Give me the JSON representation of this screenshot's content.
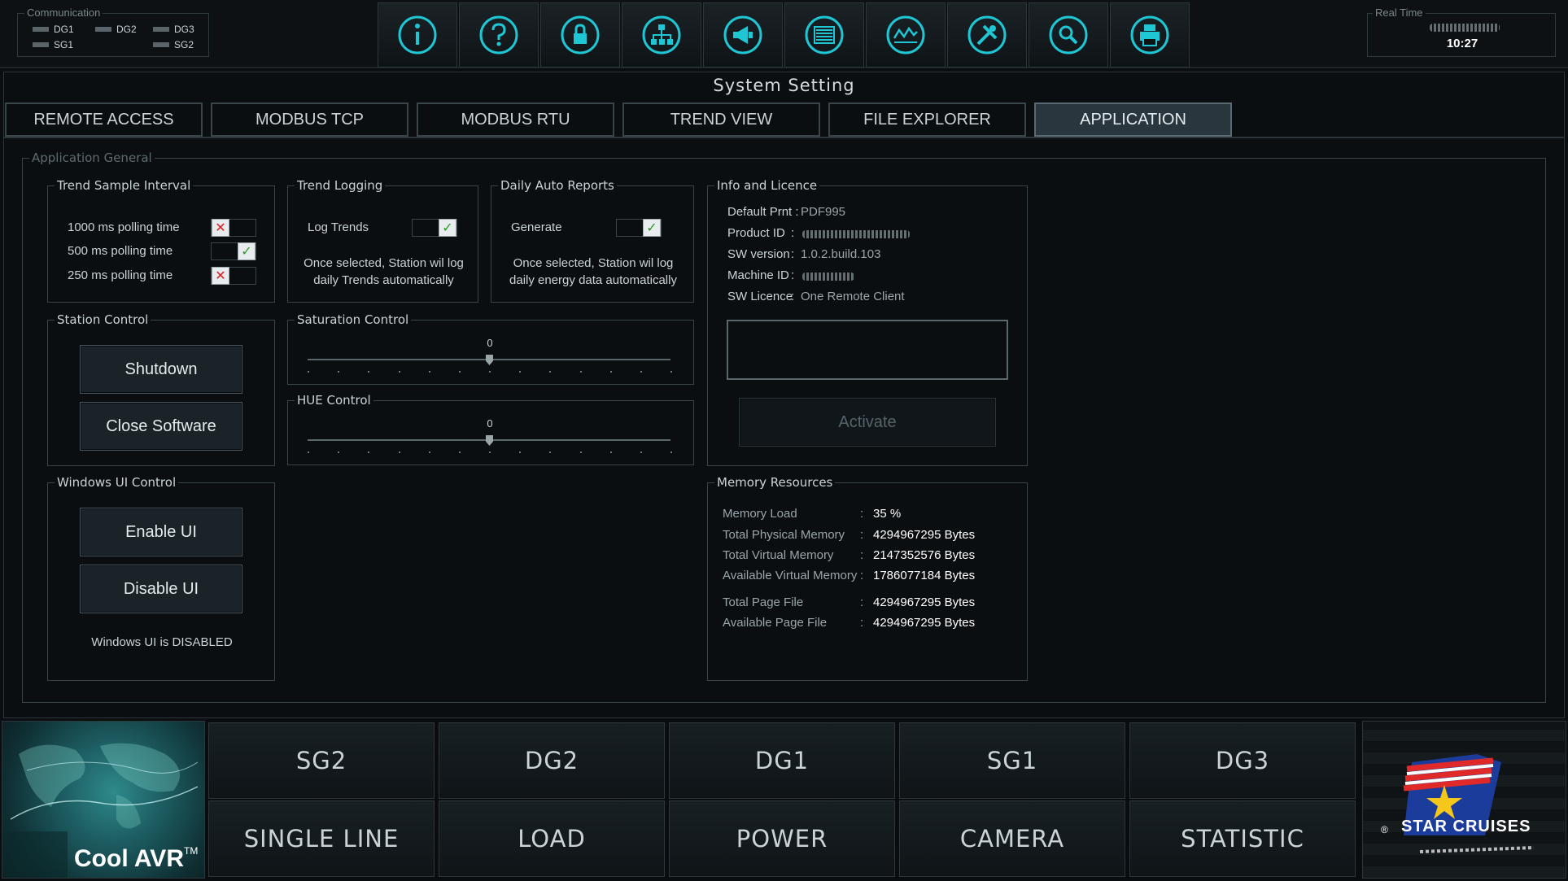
{
  "header": {
    "communication": {
      "title": "Communication",
      "items": [
        "DG1",
        "DG2",
        "DG3",
        "SG1",
        "SG2"
      ]
    },
    "toolbar": [
      {
        "icon": "info-icon"
      },
      {
        "icon": "help-icon"
      },
      {
        "icon": "lock-icon"
      },
      {
        "icon": "network-icon"
      },
      {
        "icon": "alarm-horn-icon"
      },
      {
        "icon": "list-icon"
      },
      {
        "icon": "trend-icon"
      },
      {
        "icon": "tools-icon"
      },
      {
        "icon": "search-icon"
      },
      {
        "icon": "printer-icon"
      }
    ],
    "real_time": {
      "title": "Real Time",
      "time": "10:27"
    }
  },
  "page_title": "System Setting",
  "tabs": [
    {
      "label": "REMOTE ACCESS",
      "active": false
    },
    {
      "label": "MODBUS TCP",
      "active": false
    },
    {
      "label": "MODBUS RTU",
      "active": false
    },
    {
      "label": "TREND VIEW",
      "active": false
    },
    {
      "label": "FILE EXPLORER",
      "active": false
    },
    {
      "label": "APPLICATION",
      "active": true
    }
  ],
  "application_general": {
    "title": "Application General",
    "trend_sample_interval": {
      "title": "Trend Sample Interval",
      "options": [
        {
          "label": "1000 ms polling time",
          "checked": false
        },
        {
          "label": "500 ms polling time",
          "checked": true
        },
        {
          "label": "250 ms polling time",
          "checked": false
        }
      ]
    },
    "trend_logging": {
      "title": "Trend Logging",
      "option_label": "Log Trends",
      "checked": true,
      "note_line1": "Once selected, Station wil log",
      "note_line2": "daily Trends automatically"
    },
    "daily_auto_reports": {
      "title": "Daily Auto Reports",
      "option_label": "Generate",
      "checked": true,
      "note_line1": "Once selected, Station wil log",
      "note_line2": "daily energy data automatically"
    },
    "station_control": {
      "title": "Station Control",
      "shutdown_label": "Shutdown",
      "close_label": "Close Software"
    },
    "saturation_control": {
      "title": "Saturation Control",
      "value": "0"
    },
    "hue_control": {
      "title": "HUE Control",
      "value": "0"
    },
    "windows_ui_control": {
      "title": "Windows UI Control",
      "enable_label": "Enable UI",
      "disable_label": "Disable UI",
      "status": "Windows UI is DISABLED"
    },
    "info_licence": {
      "title": "Info and Licence",
      "rows": [
        {
          "key": "Default Prnt :",
          "value": "PDF995"
        },
        {
          "key": "Product ID",
          "sep": ":",
          "value": ""
        },
        {
          "key": "SW version",
          "sep": ":",
          "value": "1.0.2.build.103"
        },
        {
          "key": "Machine ID",
          "sep": ":",
          "value": ""
        },
        {
          "key": "SW Licence",
          "sep": ":",
          "value": "One Remote Client"
        }
      ],
      "licence_input_value": "",
      "activate_label": "Activate"
    },
    "memory_resources": {
      "title": "Memory Resources",
      "rows": [
        {
          "key": "Memory Load",
          "value": "35 %"
        },
        {
          "key": "Total Physical Memory",
          "value": "4294967295 Bytes"
        },
        {
          "key": "Total Virtual Memory",
          "value": "2147352576 Bytes"
        },
        {
          "key": "Available Virtual Memory",
          "value": "1786077184 Bytes"
        },
        {
          "key": "Total Page File",
          "value": "4294967295 Bytes"
        },
        {
          "key": "Available Page File",
          "value": "4294967295 Bytes"
        }
      ]
    }
  },
  "bottom_nav": {
    "row1": [
      "SG2",
      "DG2",
      "DG1",
      "SG1",
      "DG3"
    ],
    "row2": [
      "SINGLE LINE",
      "LOAD",
      "POWER",
      "CAMERA",
      "STATISTIC"
    ],
    "left_logo_text": "Cool AVR",
    "left_logo_tm": "TM",
    "right_logo_text": "STAR CRUISES",
    "right_logo_reg": "®"
  },
  "colors": {
    "background": "#0b0e10",
    "accent_cyan": "#1fc7d4",
    "check_green": "#2a9a2a",
    "cross_red": "#d81c1c"
  }
}
